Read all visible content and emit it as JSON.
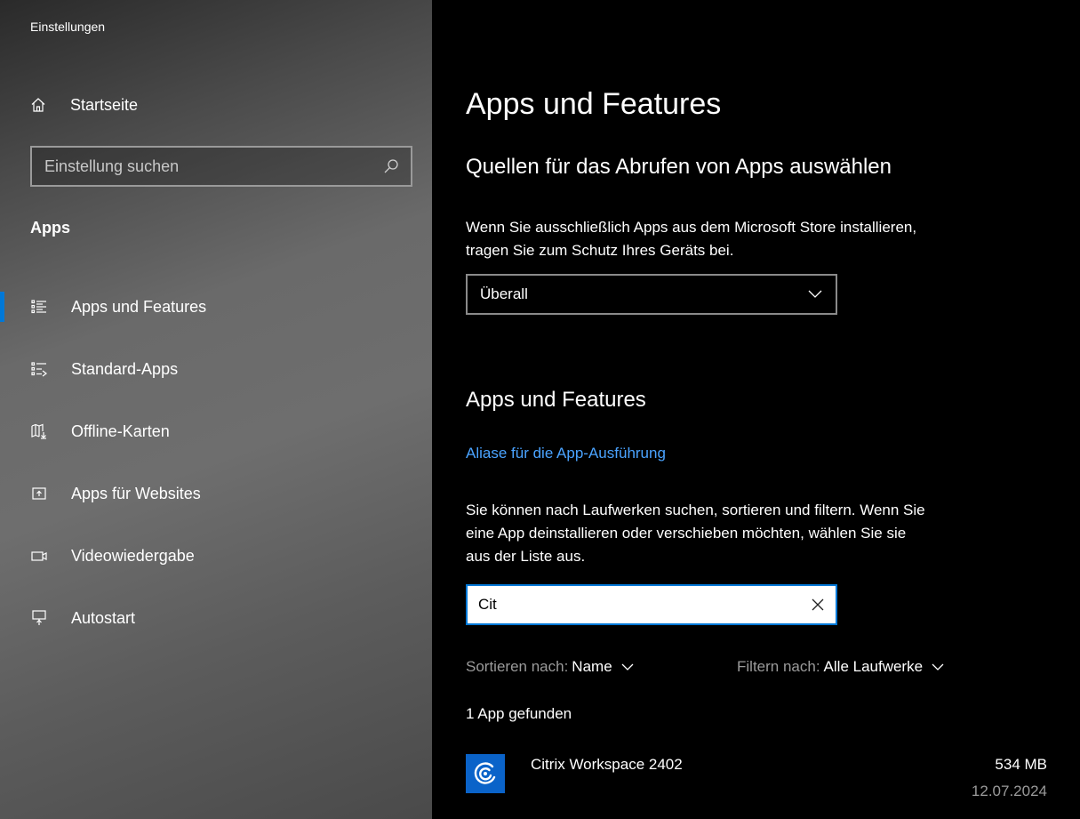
{
  "window": {
    "title": "Einstellungen"
  },
  "sidebar": {
    "home_label": "Startseite",
    "search_placeholder": "Einstellung suchen",
    "section_label": "Apps",
    "items": [
      {
        "label": "Apps und Features",
        "icon": "list-detail-icon",
        "active": true
      },
      {
        "label": "Standard-Apps",
        "icon": "list-default-icon",
        "active": false
      },
      {
        "label": "Offline-Karten",
        "icon": "map-download-icon",
        "active": false
      },
      {
        "label": "Apps für Websites",
        "icon": "open-in-app-icon",
        "active": false
      },
      {
        "label": "Videowiedergabe",
        "icon": "video-icon",
        "active": false
      },
      {
        "label": "Autostart",
        "icon": "startup-icon",
        "active": false
      }
    ]
  },
  "main": {
    "page_title": "Apps und Features",
    "sources": {
      "heading": "Quellen für das Abrufen von Apps auswählen",
      "description_line1": "Wenn Sie ausschließlich Apps aus dem Microsoft Store installieren,",
      "description_line2": "tragen Sie zum Schutz Ihres Geräts bei.",
      "dropdown_value": "Überall"
    },
    "apps": {
      "heading": "Apps und Features",
      "alias_link": "Aliase für die App-Ausführung",
      "description_line1": "Sie können nach Laufwerken suchen, sortieren und filtern. Wenn Sie",
      "description_line2": "eine App deinstallieren oder verschieben möchten, wählen Sie sie",
      "description_line3": "aus der Liste aus.",
      "search_value": "Cit",
      "sort_label": "Sortieren nach:",
      "sort_value": "Name",
      "filter_label": "Filtern nach:",
      "filter_value": "Alle Laufwerke",
      "result_count": "1 App gefunden",
      "list": [
        {
          "name": "Citrix Workspace 2402",
          "size": "534 MB",
          "date": "12.07.2024",
          "icon": "citrix-icon"
        }
      ]
    }
  },
  "colors": {
    "accent": "#0078d7",
    "link": "#4aa3ff",
    "app_icon_bg": "#0a63c9",
    "muted_text": "#9a9a9a"
  }
}
